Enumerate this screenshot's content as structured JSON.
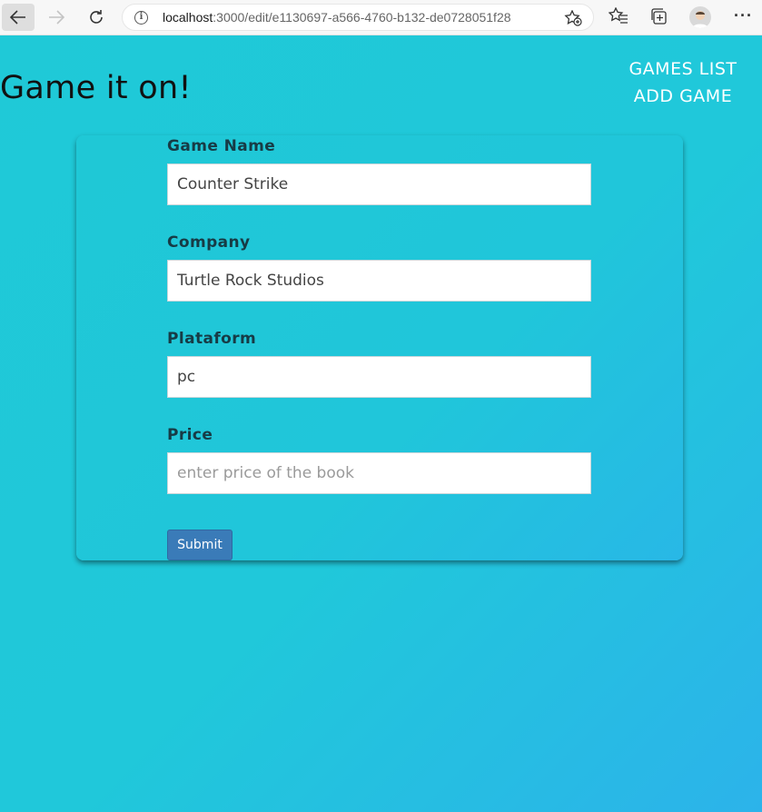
{
  "browser": {
    "url_host": "localhost",
    "url_path": ":3000/edit/e1130697-a566-4760-b132-de0728051f28"
  },
  "app": {
    "title": "Game it on!",
    "nav": [
      {
        "label": "GAMES LIST"
      },
      {
        "label": "ADD GAME"
      }
    ]
  },
  "form": {
    "fields": [
      {
        "label": "Game Name",
        "value": "Counter Strike",
        "placeholder": ""
      },
      {
        "label": "Company",
        "value": "Turtle Rock Studios",
        "placeholder": ""
      },
      {
        "label": "Plataform",
        "value": "pc",
        "placeholder": ""
      },
      {
        "label": "Price",
        "value": "",
        "placeholder": "enter price of the book"
      }
    ],
    "submit_label": "Submit"
  },
  "colors": {
    "background": "#20c8da",
    "submit": "#3a7bb8"
  }
}
